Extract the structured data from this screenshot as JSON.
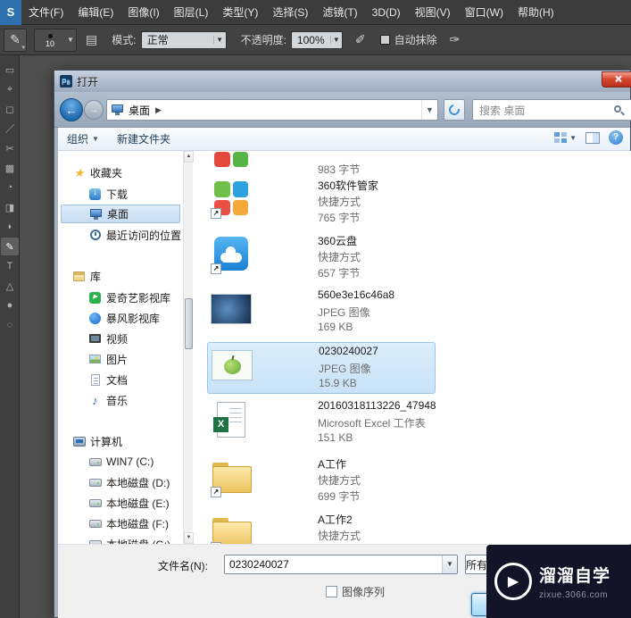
{
  "menubar": {
    "logo_text": "S",
    "items": [
      "文件(F)",
      "编辑(E)",
      "图像(I)",
      "图层(L)",
      "类型(Y)",
      "选择(S)",
      "滤镜(T)",
      "3D(D)",
      "视图(V)",
      "窗口(W)",
      "帮助(H)"
    ]
  },
  "options_bar": {
    "brush_size": "10",
    "mode_label": "模式:",
    "mode_value": "正常",
    "opacity_label": "不透明度:",
    "opacity_value": "100%",
    "auto_erase_label": "自动抹除"
  },
  "dialog": {
    "title": "打开",
    "nav": {
      "location": "桌面",
      "search_placeholder": "搜索 桌面"
    },
    "toolbar": {
      "organize_label": "组织",
      "new_folder_label": "新建文件夹"
    },
    "sidebar": {
      "groups": [
        {
          "name": "收藏夹",
          "icon": "star-icon",
          "items": [
            {
              "label": "下载",
              "icon": "download-icon"
            },
            {
              "label": "桌面",
              "icon": "desktop-icon",
              "selected": true
            },
            {
              "label": "最近访问的位置",
              "icon": "clock-icon"
            }
          ]
        },
        {
          "name": "库",
          "icon": "library-icon",
          "items": [
            {
              "label": "爱奇艺影视库",
              "icon": "iqiyi-icon"
            },
            {
              "label": "暴风影视库",
              "icon": "storm-icon"
            },
            {
              "label": "视频",
              "icon": "video-icon"
            },
            {
              "label": "图片",
              "icon": "pictures-icon"
            },
            {
              "label": "文档",
              "icon": "documents-icon"
            },
            {
              "label": "音乐",
              "icon": "music-icon"
            }
          ]
        },
        {
          "name": "计算机",
          "icon": "computer-icon",
          "items": [
            {
              "label": "WIN7 (C:)",
              "icon": "disk-icon"
            },
            {
              "label": "本地磁盘 (D:)",
              "icon": "disk-icon"
            },
            {
              "label": "本地磁盘 (E:)",
              "icon": "disk-icon"
            },
            {
              "label": "本地磁盘 (F:)",
              "icon": "disk-icon"
            },
            {
              "label": "本地磁盘 (G:)",
              "icon": "disk-icon"
            }
          ]
        }
      ]
    },
    "files": [
      {
        "name": "",
        "type": "",
        "size": "983 字节",
        "icon": "app-grid-partial"
      },
      {
        "name": "360软件管家",
        "type": "快捷方式",
        "size": "765 字节",
        "icon": "app-360-manager"
      },
      {
        "name": "360云盘",
        "type": "快捷方式",
        "size": "657 字节",
        "icon": "app-360-cloud"
      },
      {
        "name": "560e3e16c46a8",
        "type": "JPEG 图像",
        "size": "169 KB",
        "icon": "photo-thumbnail"
      },
      {
        "name": "0230240027",
        "type": "JPEG 图像",
        "size": "15.9 KB",
        "icon": "apple-thumbnail",
        "selected": true
      },
      {
        "name": "20160318113226_47948",
        "type": "Microsoft Excel 工作表",
        "size": "151 KB",
        "icon": "excel-file"
      },
      {
        "name": "A工作",
        "type": "快捷方式",
        "size": "699 字节",
        "icon": "folder-shortcut"
      },
      {
        "name": "A工作2",
        "type": "快捷方式",
        "size": "",
        "icon": "folder-shortcut"
      }
    ],
    "footer": {
      "filename_label": "文件名(N):",
      "filename_value": "0230240027",
      "filetype_value": "所有",
      "sequence_label": "图像序列"
    }
  },
  "watermark": {
    "brand": "溜溜自学",
    "domain": "zixue.3066.com"
  },
  "colors": {
    "selection_fill": "#cce4fa",
    "selection_border": "#98c5e8",
    "accent_blue": "#2d7dd2",
    "close_red": "#c9341f"
  }
}
